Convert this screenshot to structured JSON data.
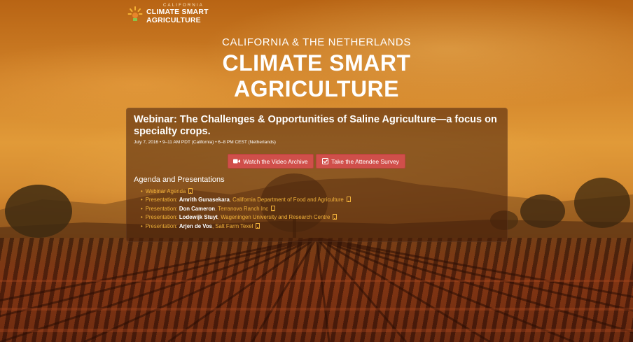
{
  "logo": {
    "top_text": "CALIFORNIA",
    "line1": "CLIMATE SMART",
    "line2": "AGRICULTURE",
    "icon": "sun-rays-icon"
  },
  "hero": {
    "subtitle": "CALIFORNIA & THE NETHERLANDS",
    "title_line1": "CLIMATE SMART",
    "title_line2": "AGRICULTURE"
  },
  "panel": {
    "title": "Webinar: The Challenges & Opportunities of Saline Agriculture—a focus on specialty crops.",
    "date": "July 7, 2016 • 9–11 AM PDT (California) • 6–8 PM CEST (Netherlands)",
    "buttons": {
      "video_label": "Watch the Video Archive",
      "video_icon": "video-camera-icon",
      "survey_label": "Take the Attendee Survey",
      "survey_icon": "checkbox-icon"
    },
    "agenda_heading": "Agenda and Presentations",
    "agenda": [
      {
        "label": "Webinar Agenda",
        "speaker": "",
        "org": ""
      },
      {
        "label": "Presentation: ",
        "speaker": "Amrith Gunasekara",
        "org": ", California Department of Food and Agriculture"
      },
      {
        "label": "Presentation: ",
        "speaker": "Don Cameron",
        "org": ", Terranova Ranch Inc"
      },
      {
        "label": "Presentation: ",
        "speaker": "Lodewijk Stuyt",
        "org": ", Wageningen University and Research Centre"
      },
      {
        "label": "Presentation: ",
        "speaker": "Arjen de Vos",
        "org": ", Salt Farm Texel"
      }
    ]
  },
  "colors": {
    "accent_button": "#d04f4a",
    "link": "#f2b23a",
    "panel_bg": "rgba(70,30,10,0.55)"
  }
}
